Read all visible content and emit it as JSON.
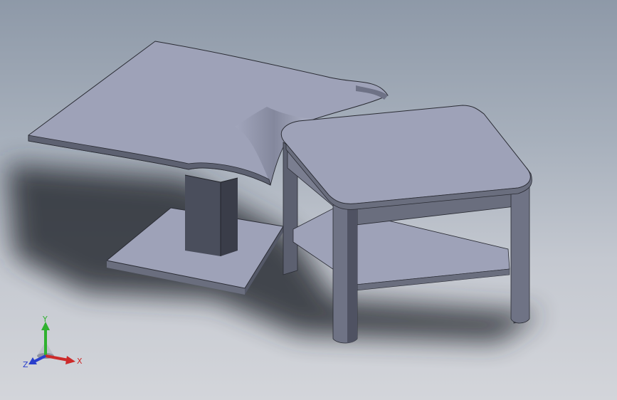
{
  "triad": {
    "x_label": "X",
    "y_label": "Y",
    "z_label": "Z"
  },
  "colors": {
    "background_top": "#8e99a8",
    "background_bottom": "#d3d5da",
    "model_top_face": "#9ea2b8",
    "model_side_face": "#5c6070",
    "model_dark_face": "#474a57",
    "axis_x": "#cc2a2a",
    "axis_y": "#2fb12f",
    "axis_z": "#2a3fcc"
  }
}
